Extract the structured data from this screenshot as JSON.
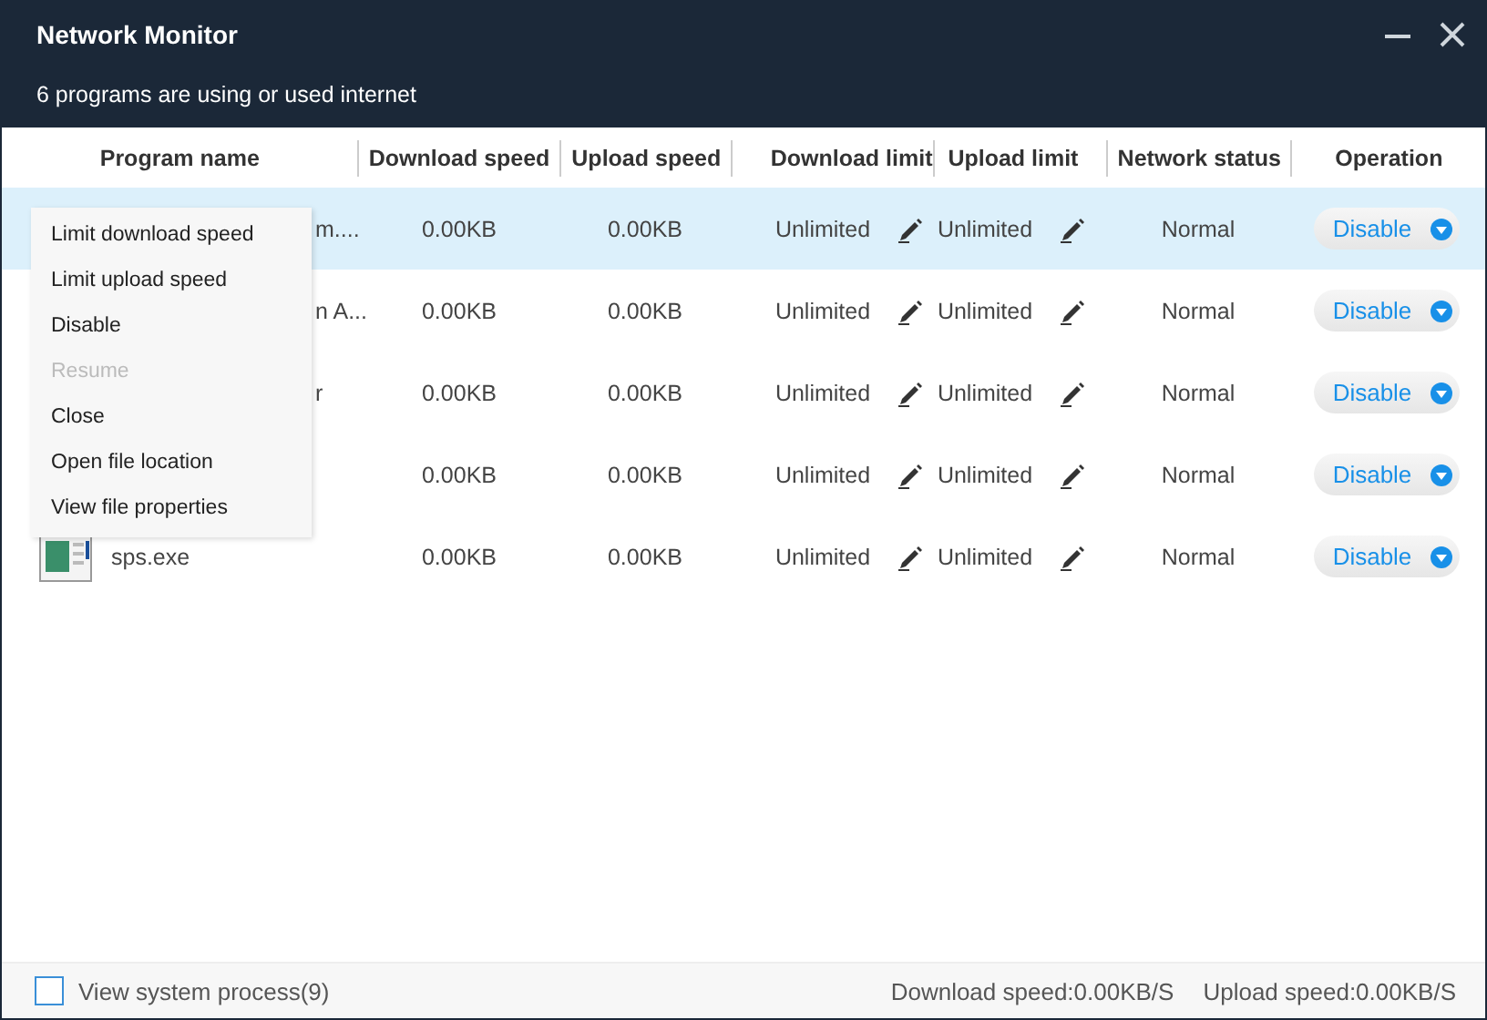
{
  "window": {
    "title": "Network Monitor",
    "subtitle": "6 programs are using or used internet"
  },
  "table": {
    "columns": [
      "Program name",
      "Download speed",
      "Upload speed",
      "Download limit",
      "Upload limit",
      "Network status",
      "Operation"
    ],
    "rows": [
      {
        "name": "m....",
        "has_icon": false,
        "download_speed": "0.00KB",
        "upload_speed": "0.00KB",
        "download_limit": "Unlimited",
        "upload_limit": "Unlimited",
        "status": "Normal",
        "operation": "Disable",
        "selected": true
      },
      {
        "name": "n A...",
        "has_icon": false,
        "download_speed": "0.00KB",
        "upload_speed": "0.00KB",
        "download_limit": "Unlimited",
        "upload_limit": "Unlimited",
        "status": "Normal",
        "operation": "Disable",
        "selected": false
      },
      {
        "name": "r",
        "has_icon": false,
        "download_speed": "0.00KB",
        "upload_speed": "0.00KB",
        "download_limit": "Unlimited",
        "upload_limit": "Unlimited",
        "status": "Normal",
        "operation": "Disable",
        "selected": false
      },
      {
        "has_icon": false,
        "download_speed": "0.00KB",
        "upload_speed": "0.00KB",
        "download_limit": "Unlimited",
        "upload_limit": "Unlimited",
        "status": "Normal",
        "operation": "Disable",
        "selected": false
      },
      {
        "name": "sps.exe",
        "has_icon": true,
        "download_speed": "0.00KB",
        "upload_speed": "0.00KB",
        "download_limit": "Unlimited",
        "upload_limit": "Unlimited",
        "status": "Normal",
        "operation": "Disable",
        "selected": false
      }
    ]
  },
  "context_menu": {
    "items": [
      {
        "label": "Limit download speed",
        "disabled": false
      },
      {
        "label": "Limit upload speed",
        "disabled": false
      },
      {
        "label": "Disable",
        "disabled": false
      },
      {
        "label": "Resume",
        "disabled": true
      },
      {
        "label": "Close",
        "disabled": false
      },
      {
        "label": "Open file location",
        "disabled": false
      },
      {
        "label": "View file properties",
        "disabled": false
      }
    ]
  },
  "status_bar": {
    "system_process": {
      "label": "View system process(9)",
      "checked": false
    },
    "download_speed": "Download speed:0.00KB/S",
    "upload_speed": "Upload speed:0.00KB/S"
  }
}
